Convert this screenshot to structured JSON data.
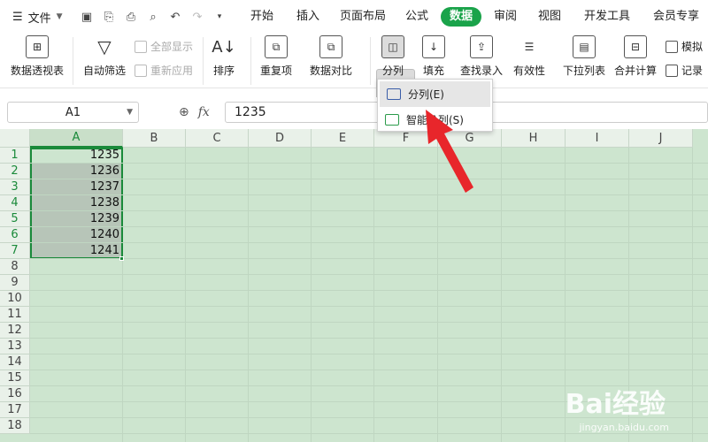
{
  "menubar": {
    "file_label": "文件",
    "tabs": [
      "开始",
      "插入",
      "页面布局",
      "公式",
      "数据",
      "审阅",
      "视图",
      "开发工具",
      "会员专享"
    ],
    "active_tab": "数据"
  },
  "ribbon": {
    "pivot": "数据透视表",
    "autofilter": "自动筛选",
    "show_all": "全部显示",
    "reapply": "重新应用",
    "sort": "排序",
    "duplicates": "重复项",
    "compare": "数据对比",
    "split": "分列",
    "fill": "填充",
    "lookup": "查找录入",
    "validity": "有效性",
    "dropdown_list": "下拉列表",
    "consolidate": "合并计算",
    "simulate": "模拟",
    "record": "记录"
  },
  "dropdown": {
    "items": [
      "分列(E)",
      "智能分列(S)"
    ]
  },
  "formula_bar": {
    "name_box": "A1",
    "fx_label": "fx",
    "value": "1235"
  },
  "sheet": {
    "columns": [
      "A",
      "B",
      "C",
      "D",
      "E",
      "F",
      "G",
      "H",
      "I",
      "J"
    ],
    "rows": [
      "1",
      "2",
      "3",
      "4",
      "5",
      "6",
      "7",
      "8",
      "9",
      "10",
      "11",
      "12",
      "13",
      "14",
      "15",
      "16",
      "17",
      "18"
    ],
    "colA_values": [
      "1235",
      "1236",
      "1237",
      "1238",
      "1239",
      "1240",
      "1241"
    ]
  },
  "watermark": {
    "brand": "Bai经验",
    "url": "jingyan.baidu.com"
  }
}
